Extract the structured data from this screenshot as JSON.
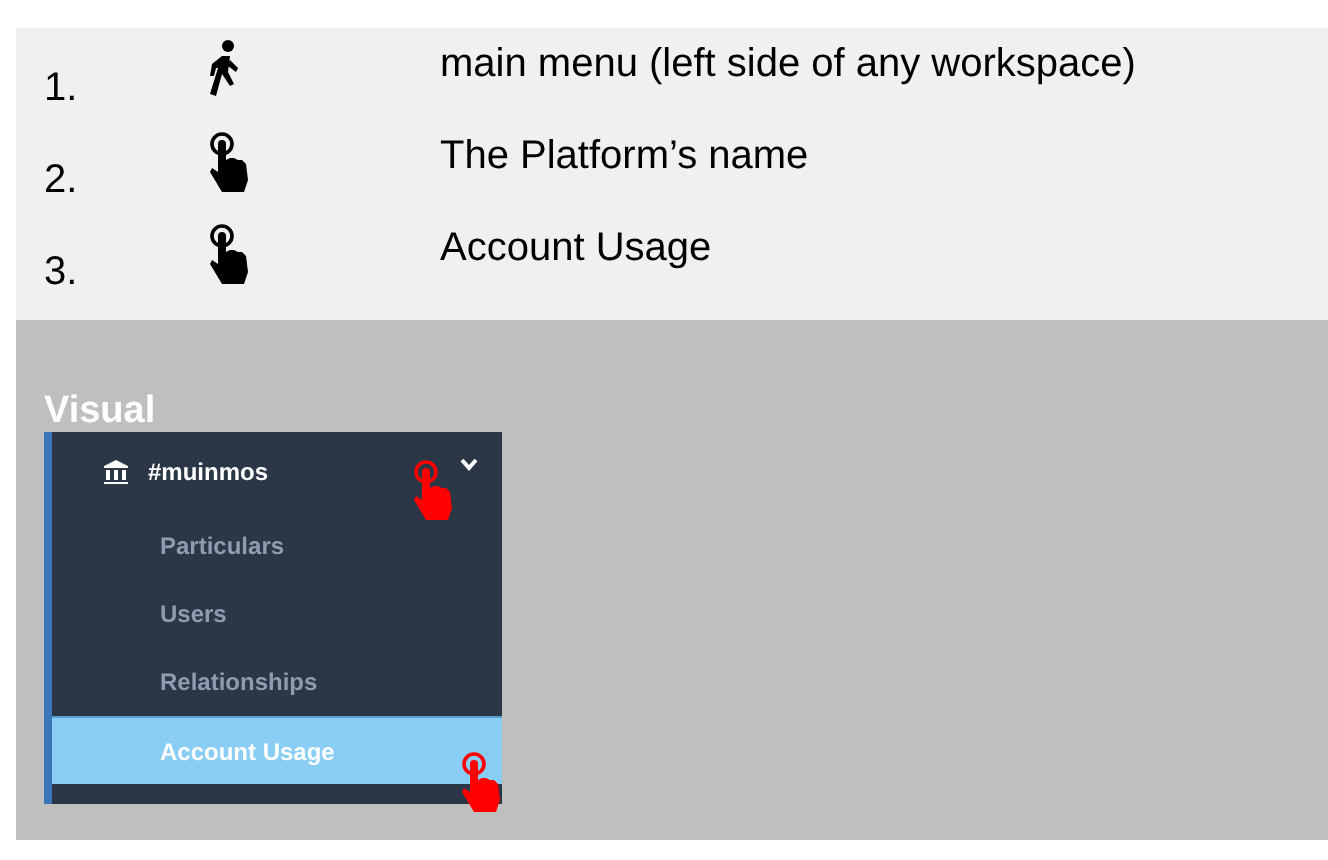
{
  "steps": [
    {
      "number": "1.",
      "kind": "walk",
      "text": "main menu (left side of any workspace)"
    },
    {
      "number": "2.",
      "kind": "tap",
      "text": "The Platform’s name"
    },
    {
      "number": "3.",
      "kind": "tap",
      "text": "Account Usage"
    }
  ],
  "visual": {
    "heading": "Visual",
    "menu": {
      "title": "#muinmos",
      "expanded": true,
      "items": [
        {
          "label": "Particulars",
          "selected": false
        },
        {
          "label": "Users",
          "selected": false
        },
        {
          "label": "Relationships",
          "selected": false
        },
        {
          "label": "Account Usage",
          "selected": true
        }
      ]
    }
  }
}
